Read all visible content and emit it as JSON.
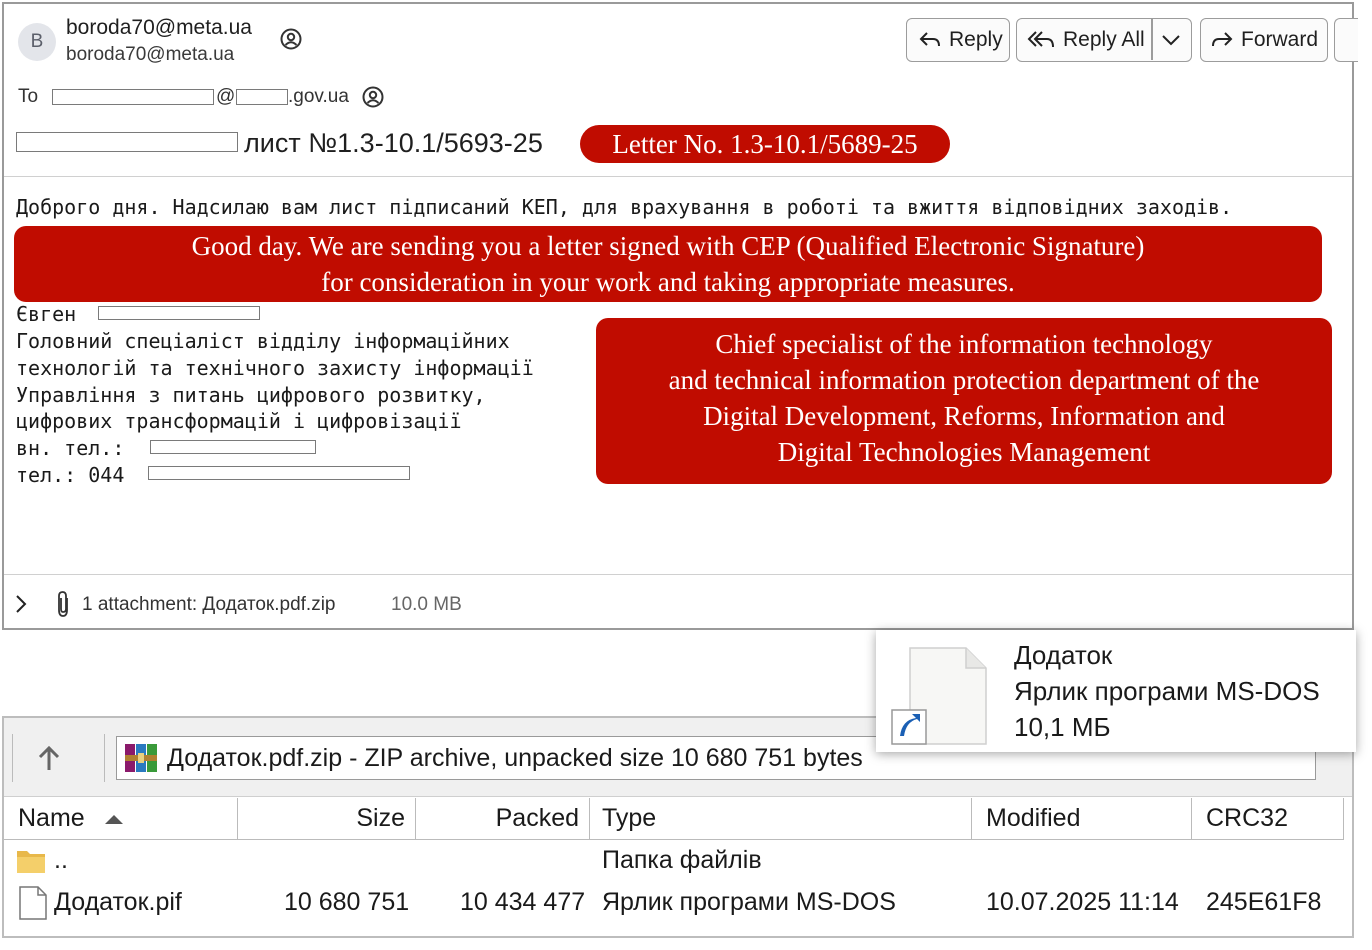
{
  "email": {
    "sender": {
      "avatar_letter": "B",
      "name": "boroda70@meta.ua",
      "address": "boroda70@meta.ua"
    },
    "toolbar": {
      "reply": "Reply",
      "reply_all": "Reply All",
      "forward": "Forward"
    },
    "to": {
      "label": "To",
      "at": "@",
      "domain_suffix": ".gov.ua"
    },
    "subject": {
      "text": "лист №1.3-10.1/5693-25",
      "translation": "Letter No. 1.3-10.1/5689-25"
    },
    "body": {
      "greeting": "Доброго дня. Надсилаю вам лист підписаний КЕП, для врахування в роботі та вжиття відповідних заходів.",
      "greeting_translation_line1": "Good day. We are sending you a letter signed with CEP (Qualified Electronic Signature)",
      "greeting_translation_line2": "for consideration in your work and taking appropriate measures.",
      "signature": {
        "name": "Євген",
        "line1": "Головний спеціаліст відділу інформаційних",
        "line2": "технологій та технічного захисту інформації",
        "line3": "Управління з питань цифрового розвитку,",
        "line4": "цифрових трансформацій і цифровізації",
        "ext_phone_label": "вн. тел.:",
        "phone_label": "тел.: 044"
      },
      "signature_translation": [
        "Chief specialist of the information technology",
        "and technical information protection  department of the",
        "Digital Development, Reforms, Information and",
        "Digital Technologies Management"
      ]
    },
    "attachment": {
      "summary": "1 attachment: Додаток.pdf.zip",
      "size": "10.0 MB"
    }
  },
  "tooltip": {
    "name": "Додаток",
    "type": "Ярлик програми MS-DOS",
    "size": "10,1 МБ"
  },
  "archive": {
    "path": "Додаток.pdf.zip - ZIP archive, unpacked size 10 680 751 bytes",
    "columns": [
      "Name",
      "Size",
      "Packed",
      "Type",
      "Modified",
      "CRC32"
    ],
    "rows": [
      {
        "name": "..",
        "size": "",
        "packed": "",
        "type": "Папка файлів",
        "modified": "",
        "crc": ""
      },
      {
        "name": "Додаток.pif",
        "size": "10 680 751",
        "packed": "10 434 477",
        "type": "Ярлик програми MS-DOS",
        "modified": "10.07.2025 11:14",
        "crc": "245E61F8"
      }
    ]
  },
  "colors": {
    "annotation_red": "#c00c00",
    "folder_yellow": "#e8b84a"
  }
}
